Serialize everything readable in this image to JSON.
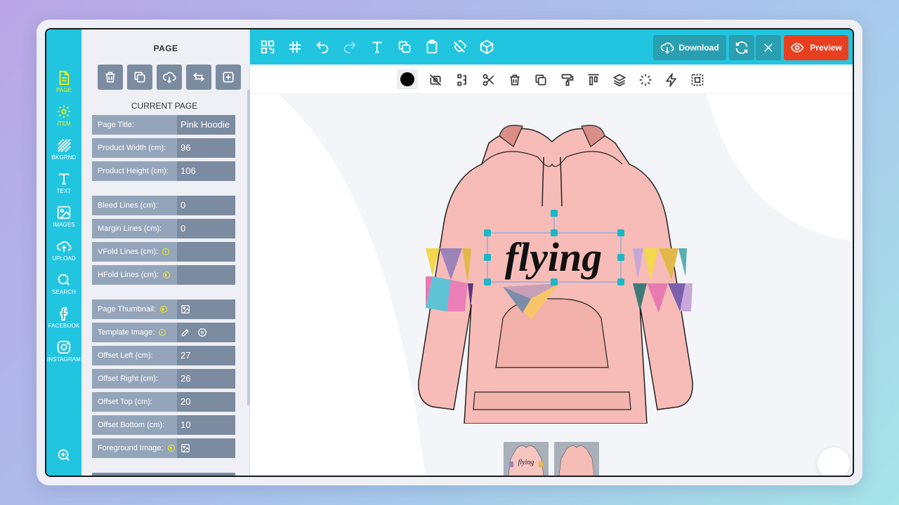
{
  "rail": {
    "items": [
      {
        "label": "PAGE",
        "icon": "page-icon"
      },
      {
        "label": "ITEM",
        "icon": "gear-icon"
      },
      {
        "label": "BKGRND",
        "icon": "stripes-icon"
      },
      {
        "label": "TEXT",
        "icon": "text-icon"
      },
      {
        "label": "IMAGES",
        "icon": "image-icon"
      },
      {
        "label": "UPLOAD",
        "icon": "upload-icon"
      },
      {
        "label": "SEARCH",
        "icon": "search-icon"
      },
      {
        "label": "FACEBOOK",
        "icon": "facebook-icon"
      },
      {
        "label": "INSTAGRAM",
        "icon": "instagram-icon"
      }
    ],
    "active_color": "#f5f00a",
    "background": "#21c5e0"
  },
  "panel": {
    "title": "PAGE",
    "section_title": "CURRENT PAGE",
    "fields": {
      "page_title": {
        "label": "Page Title:",
        "value": "Pink Hoodie"
      },
      "product_width": {
        "label": "Product Width (cm):",
        "value": "96"
      },
      "product_height": {
        "label": "Product Height (cm):",
        "value": "106"
      },
      "bleed_lines": {
        "label": "Bleed Lines (cm):",
        "value": "0"
      },
      "margin_lines": {
        "label": "Margin Lines (cm):",
        "value": "0"
      },
      "vfold_lines": {
        "label": "VFold Lines (cm):",
        "value": ""
      },
      "hfold_lines": {
        "label": "HFold Lines (cm):",
        "value": ""
      },
      "page_thumbnail": {
        "label": "Page Thumbnail:"
      },
      "template_image": {
        "label": "Template Image:"
      },
      "offset_left": {
        "label": "Offset Left (cm):",
        "value": "27"
      },
      "offset_right": {
        "label": "Offset Right (cm):",
        "value": "26"
      },
      "offset_top": {
        "label": "Offset Top (cm):",
        "value": "20"
      },
      "offset_bottom": {
        "label": "Offset Bottom (cm):",
        "value": "10"
      },
      "foreground_image": {
        "label": "Foreground Image:"
      }
    }
  },
  "topbar": {
    "download_label": "Download",
    "preview_label": "Preview",
    "accent": "#21c5e0",
    "preview_color": "#e8401f"
  },
  "canvas": {
    "design_text": "flying",
    "thumb_text": "flying",
    "hoodie_color": "#f7bcb7"
  }
}
